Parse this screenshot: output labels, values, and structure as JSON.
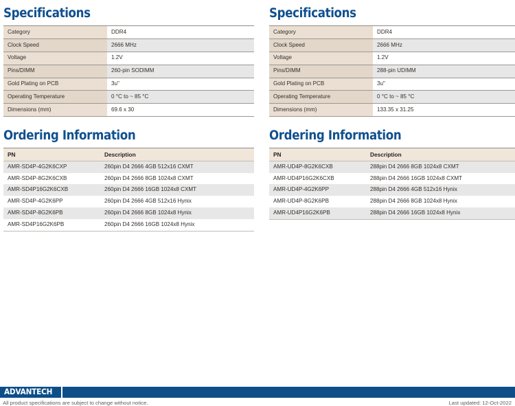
{
  "left": {
    "spec_title": "Specifications",
    "spec_rows": [
      {
        "label": "Category",
        "value": "DDR4"
      },
      {
        "label": "Clock Speed",
        "value": "2666 MHz"
      },
      {
        "label": "Voltage",
        "value": "1.2V"
      },
      {
        "label": "Pins/DIMM",
        "value": "260-pin SODIMM"
      },
      {
        "label": "Gold Plating on PCB",
        "value": "3u\""
      },
      {
        "label": "Operating Temperature",
        "value": "0 °C to ~ 85 °C"
      },
      {
        "label": "Dimensions (mm)",
        "value": "69.6 x 30"
      }
    ],
    "ordering_title": "Ordering Information",
    "ordering_headers": {
      "pn": "PN",
      "description": "Description"
    },
    "ordering_rows": [
      {
        "pn": "AMR-SD4P-4G2K6CXP",
        "description": "260pin D4 2666 4GB  512x16 CXMT"
      },
      {
        "pn": "AMR-SD4P-8G2K6CXB",
        "description": "260pin D4 2666 8GB 1024x8 CXMT"
      },
      {
        "pn": "AMR-SD4P16G2K6CXB",
        "description": "260pin D4 2666 16GB 1024x8 CXMT"
      },
      {
        "pn": "AMR-SD4P-4G2K6PP",
        "description": "260pin D4 2666 4GB 512x16 Hynix"
      },
      {
        "pn": "AMR-SD4P-8G2K6PB",
        "description": "260pin D4 2666 8GB 1024x8 Hynix"
      },
      {
        "pn": "AMR-SD4P16G2K6PB",
        "description": "260pin D4 2666 16GB 1024x8 Hynix"
      }
    ]
  },
  "right": {
    "spec_title": "Specifications",
    "spec_rows": [
      {
        "label": "Category",
        "value": "DDR4"
      },
      {
        "label": "Clock Speed",
        "value": "2666 MHz"
      },
      {
        "label": "Voltage",
        "value": "1.2V"
      },
      {
        "label": "Pins/DIMM",
        "value": "288-pin UDIMM"
      },
      {
        "label": "Gold Plating on PCB",
        "value": "3u\""
      },
      {
        "label": "Operating Temperature",
        "value": "0 °C to ~ 85 °C"
      },
      {
        "label": "Dimensions (mm)",
        "value": "133.35 x 31.25"
      }
    ],
    "ordering_title": "Ordering Information",
    "ordering_headers": {
      "pn": "PN",
      "description": "Description"
    },
    "ordering_rows": [
      {
        "pn": "AMR-UD4P-8G2K6CXB",
        "description": "288pin D4 2666 8GB 1024x8 CXMT"
      },
      {
        "pn": "AMR-UD4P16G2K6CXB",
        "description": "288pin D4 2666 16GB 1024x8 CXMT"
      },
      {
        "pn": "AMR-UD4P-4G2K6PP",
        "description": "288pin D4 2666 4GB 512x16 Hynix"
      },
      {
        "pn": "AMR-UD4P-8G2K6PB",
        "description": "288pin D4 2666 8GB 1024x8 Hynix"
      },
      {
        "pn": "AMR-UD4P16G2K6PB",
        "description": "288pin D4 2666 16GB 1024x8 Hynix"
      }
    ]
  },
  "footer": {
    "logo_text": "ADVANTECH",
    "disclaimer": "All product specifications are subject to change without notice.",
    "last_updated": "Last updated: 12-Oct-2022"
  },
  "colors": {
    "brand_blue": "#0d4e89",
    "heading_blue": "#10508f",
    "label_beige": "#eadfd2",
    "header_beige": "#f1e6da",
    "row_gray": "#e7e7e7",
    "border_gray": "#9b9893"
  }
}
